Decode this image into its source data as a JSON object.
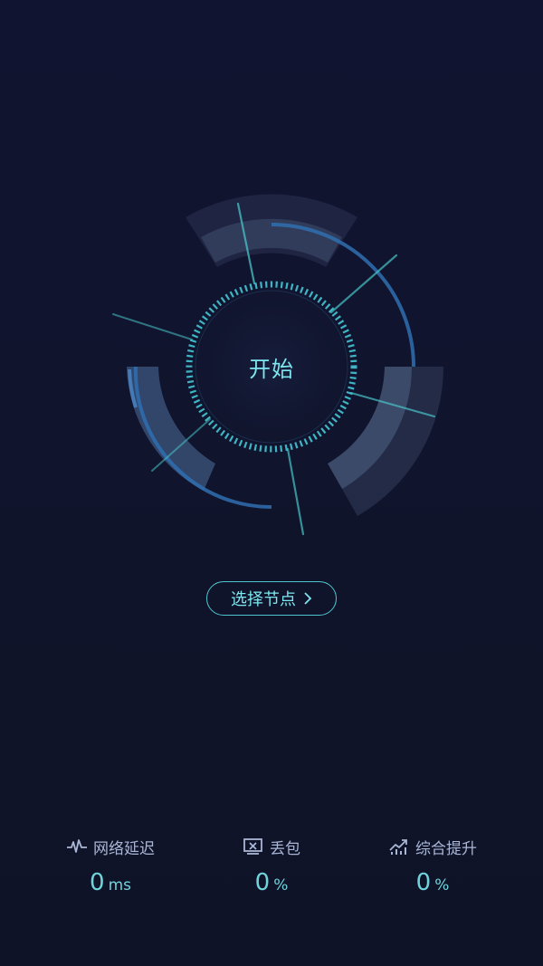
{
  "dial": {
    "start_label": "开始"
  },
  "node_select": {
    "label": "选择节点"
  },
  "stats": {
    "latency": {
      "label": "网络延迟",
      "value": "0",
      "unit": "ms",
      "icon": "pulse-icon"
    },
    "packet_loss": {
      "label": "丢包",
      "value": "0",
      "unit": "%",
      "icon": "packet-loss-icon"
    },
    "boost": {
      "label": "综合提升",
      "value": "0",
      "unit": "%",
      "icon": "trend-up-icon"
    }
  },
  "colors": {
    "background": "#10132b",
    "accent": "#4fc6cf",
    "accent_text": "#7ee6ee",
    "label_text": "#a9b6d6"
  }
}
